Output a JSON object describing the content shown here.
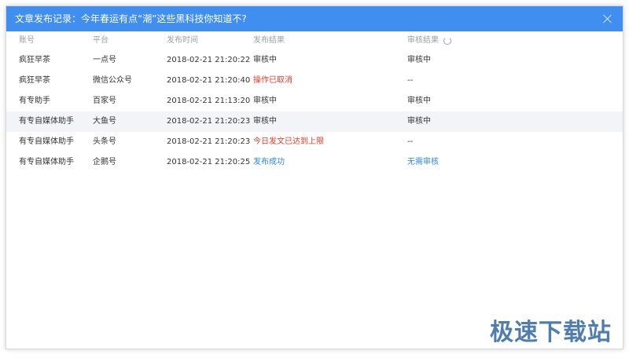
{
  "dialog": {
    "title": "文章发布记录：今年春运有点“潮”这些黑科技你知道不?"
  },
  "table": {
    "headers": [
      "账号",
      "平台",
      "发布时间",
      "发布结果",
      "审核结果"
    ],
    "rows": [
      {
        "account": "疯狂早茶",
        "platform": "一点号",
        "time": "2018-02-21 21:20:22",
        "result": "审核中",
        "result_status": "ok",
        "review": "审核中",
        "review_status": "ok"
      },
      {
        "account": "疯狂早茶",
        "platform": "微信公众号",
        "time": "2018-02-21 21:20:40",
        "result": "操作已取消",
        "result_status": "error",
        "review": "--",
        "review_status": "ok"
      },
      {
        "account": "有专助手",
        "platform": "百家号",
        "time": "2018-02-21 21:13:20",
        "result": "审核中",
        "result_status": "ok",
        "review": "审核中",
        "review_status": "ok"
      },
      {
        "account": "有专自媒体助手",
        "platform": "大鱼号",
        "time": "2018-02-21 21:20:23",
        "result": "审核中",
        "result_status": "ok",
        "review": "审核中",
        "review_status": "ok"
      },
      {
        "account": "有专自媒体助手",
        "platform": "头条号",
        "time": "2018-02-21 21:20:23",
        "result": "今日发文已达到上限",
        "result_status": "error",
        "review": "--",
        "review_status": "ok"
      },
      {
        "account": "有专自媒体助手",
        "platform": "企鹅号",
        "time": "2018-02-21 21:20:25",
        "result": "发布成功",
        "result_status": "success",
        "review": "无需审核",
        "review_status": "success"
      }
    ],
    "highlighted_row": 3
  },
  "watermark": "极速下载站",
  "colors": {
    "titlebar": "#3f8ef0",
    "error": "#e33a2a",
    "success": "#2f86e6"
  },
  "icons": {
    "close": "close-icon",
    "refresh": "refresh-icon"
  }
}
